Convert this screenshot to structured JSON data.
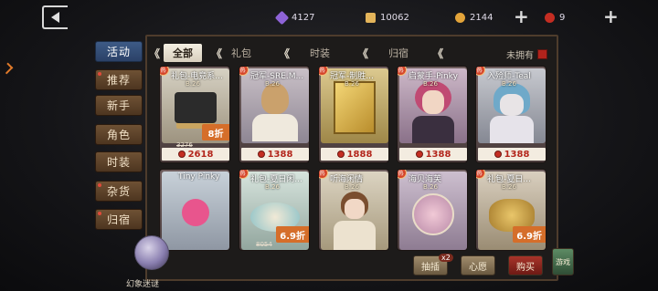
{
  "currency": {
    "purple_crystal": "4127",
    "fragments": "10062",
    "coins": "2144",
    "red_coins": "9"
  },
  "colors": {
    "active_tab": "#34507a",
    "price_red": "#b3261c",
    "discount_orange": "#d56e2a"
  },
  "side_tabs": [
    {
      "label": "活动",
      "active": true
    },
    {
      "label": "推荐",
      "active": false
    },
    {
      "label": "新手",
      "active": false
    },
    {
      "label": "角色",
      "active": false
    },
    {
      "label": "时装",
      "active": false
    },
    {
      "label": "杂货",
      "active": false
    },
    {
      "label": "归宿",
      "active": false
    }
  ],
  "filters": {
    "tabs": [
      "全部",
      "礼包",
      "时装",
      "归宿"
    ],
    "unowned_label": "未拥有"
  },
  "cards": [
    {
      "name": "礼包-电竞系...",
      "quality": "B.26",
      "discount": "8折",
      "orig": "3276",
      "price": "2618"
    },
    {
      "name": "冠军-SRE.M...",
      "quality": "B.26",
      "discount": "",
      "orig": "",
      "price": "1388"
    },
    {
      "name": "冠军-制胜...",
      "quality": "B.26",
      "discount": "",
      "orig": "",
      "price": "1888"
    },
    {
      "name": "启蒙手-Pinky",
      "quality": "B.26",
      "discount": "",
      "orig": "",
      "price": "1388"
    },
    {
      "name": "入殓师-Teal",
      "quality": "B.26",
      "discount": "",
      "orig": "",
      "price": "1388"
    },
    {
      "name": "Tiny Pinky",
      "quality": "B.26",
      "discount": "",
      "orig": "",
      "price": ""
    },
    {
      "name": "礼包-夏日闲...",
      "quality": "B.26",
      "discount": "6.9折",
      "orig": "8054",
      "price": ""
    },
    {
      "name": "听海闲情",
      "quality": "B.26",
      "discount": "",
      "orig": "",
      "price": ""
    },
    {
      "name": "海贝海芙",
      "quality": "B.26",
      "discount": "",
      "orig": "",
      "price": ""
    },
    {
      "name": "礼包-夏日...",
      "quality": "B.26",
      "discount": "6.9折",
      "orig": "",
      "price": ""
    }
  ],
  "bottom": {
    "globe_label": "幻象迷谜",
    "btn1": "抽插",
    "btn1_badge": "x2",
    "btn2": "心愿",
    "btn3": "购买",
    "btn4": "游戏"
  }
}
